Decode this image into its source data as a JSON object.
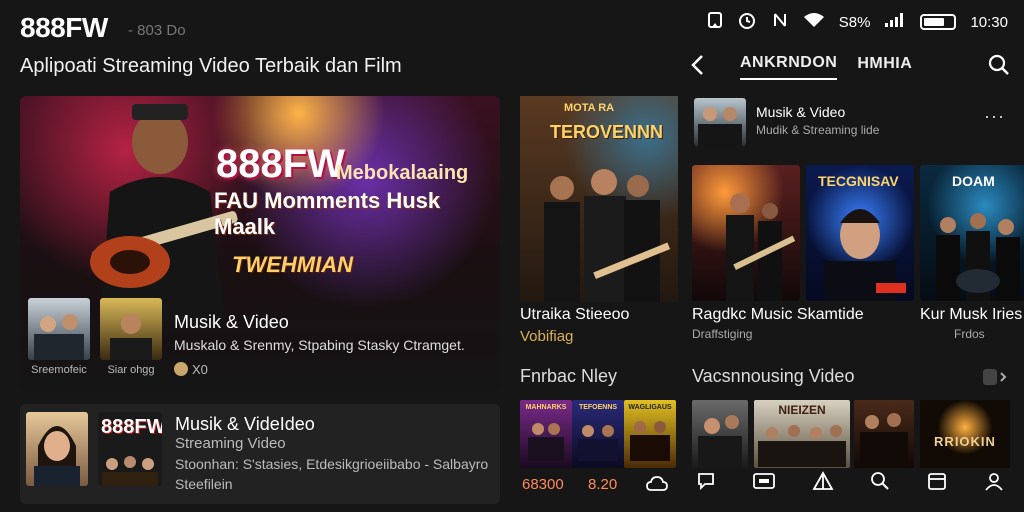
{
  "header": {
    "brand": "888FW",
    "brand_sub": "- 803 Do",
    "tagline": "Aplipoati Streaming Video Terbaik dan Film"
  },
  "status_bar": {
    "battery": "S8% ",
    "time": "10:30"
  },
  "nav": {
    "tabs": [
      {
        "label": "ANKRNDON",
        "active": true
      },
      {
        "label": "HMHIA",
        "active": false
      }
    ]
  },
  "hero": {
    "title": "888FW",
    "title_side": "Mebokalaaing",
    "subtitle": "FAU Momments Husk Maalk",
    "tag": "TWEHMIAN",
    "row1": {
      "thumbs": [
        {
          "caption": "Sreemofeic"
        },
        {
          "caption": "Siar ohgg"
        }
      ],
      "title": "Musik & Video",
      "line": "Muskalo & Srenmy, Stpabing Stasky Ctramget.",
      "meta": "X0"
    }
  },
  "row2": {
    "thumb_text": "888FW",
    "title": "Musik & VideIdeo",
    "line1": "Streaming Video",
    "line2": "Stoonhan: S'stasies, Etdesikgrioeiibabo - Salbayro",
    "line3": "Steefilein"
  },
  "side_poster": {
    "poster_title": "TEROVENNN",
    "poster_top": "MOTA RA",
    "title": "Utraika Stieeoo",
    "subtitle": "Vobifiag"
  },
  "top_item": {
    "title": "Musik & Video",
    "subtitle": "Mudik & Streaming lide"
  },
  "cards": [
    {
      "title": "Ragdkc Music Skamtide",
      "sub": "Draffstiging",
      "poster": ""
    },
    {
      "title": "",
      "sub": "",
      "poster": "TECGNISAV",
      "badge": ""
    },
    {
      "title": "Kur Musk Iries",
      "sub": "Frdos",
      "poster": "DOAM"
    }
  ],
  "section_left": {
    "title": "Fnrbac Nley",
    "posters": [
      {
        "label": "MAHNARKS"
      },
      {
        "label": "TEFOENNS"
      },
      {
        "label": "WAGLIGAUS"
      }
    ],
    "nums": [
      "68300",
      "8.20"
    ]
  },
  "section_right": {
    "title": "Vacsnnousing Video",
    "wide_label": "NIEIZEN",
    "last_label": "RRIOKIN"
  },
  "colors": {
    "bg": "#161616",
    "panel": "#222222",
    "accent": "#ff8a5a",
    "gold": "#d9b25a"
  }
}
